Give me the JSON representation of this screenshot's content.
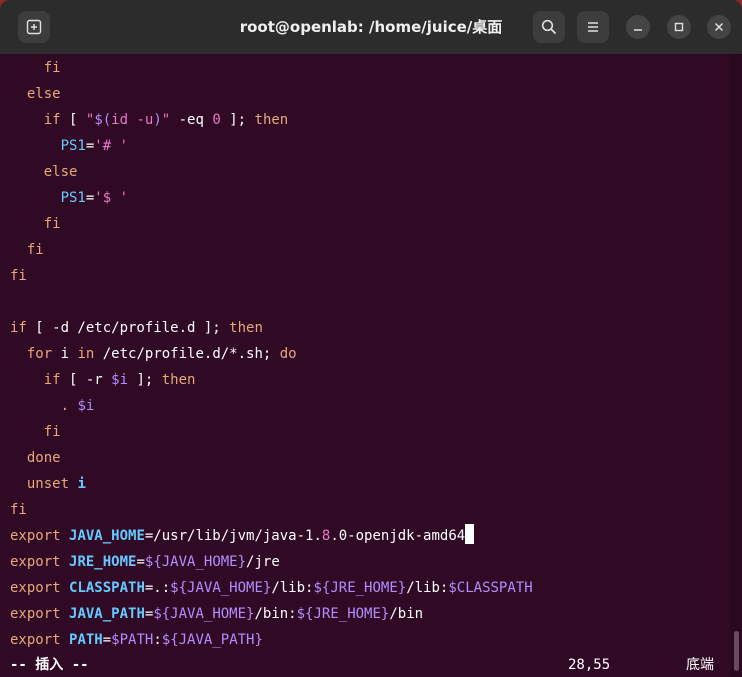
{
  "window": {
    "title": "root@openlab: /home/juice/桌面"
  },
  "colors": {
    "terminal_bg": "#300a24",
    "titlebar_bg": "#2c2c2c",
    "keyword": "#e8a87c",
    "string": "#e878c8",
    "variable": "#66c8ff",
    "comment": "#b38cff",
    "default": "#ffffff"
  },
  "icons": {
    "new_tab": "new-tab-icon",
    "search": "search-icon",
    "menu": "hamburger-menu-icon",
    "minimize": "minimize-icon",
    "maximize": "maximize-icon",
    "close": "close-icon"
  },
  "editor": {
    "lines": [
      [
        {
          "t": "    fi",
          "c": "#e8a87c"
        }
      ],
      [
        {
          "t": "  else",
          "c": "#e8a87c"
        }
      ],
      [
        {
          "t": "    if",
          "c": "#e8a87c"
        },
        {
          "t": " [ ",
          "c": "#ffffff"
        },
        {
          "t": "\"",
          "c": "#e878c8"
        },
        {
          "t": "$(",
          "c": "#b38cff"
        },
        {
          "t": "id -u",
          "c": "#e878c8"
        },
        {
          "t": ")",
          "c": "#b38cff"
        },
        {
          "t": "\"",
          "c": "#e878c8"
        },
        {
          "t": " -eq ",
          "c": "#ffffff"
        },
        {
          "t": "0",
          "c": "#e878c8"
        },
        {
          "t": " ]; ",
          "c": "#ffffff"
        },
        {
          "t": "then",
          "c": "#e8a87c"
        }
      ],
      [
        {
          "t": "      PS1",
          "c": "#66c8ff"
        },
        {
          "t": "=",
          "c": "#ffffff"
        },
        {
          "t": "'# '",
          "c": "#e878c8"
        }
      ],
      [
        {
          "t": "    else",
          "c": "#e8a87c"
        }
      ],
      [
        {
          "t": "      PS1",
          "c": "#66c8ff"
        },
        {
          "t": "=",
          "c": "#ffffff"
        },
        {
          "t": "'$ '",
          "c": "#e878c8"
        }
      ],
      [
        {
          "t": "    fi",
          "c": "#e8a87c"
        }
      ],
      [
        {
          "t": "  fi",
          "c": "#e8a87c"
        }
      ],
      [
        {
          "t": "fi",
          "c": "#e8a87c"
        }
      ],
      [
        {
          "t": "",
          "c": "#ffffff"
        }
      ],
      [
        {
          "t": "if",
          "c": "#e8a87c"
        },
        {
          "t": " [ -d /etc/profile.d ]; ",
          "c": "#ffffff"
        },
        {
          "t": "then",
          "c": "#e8a87c"
        }
      ],
      [
        {
          "t": "  for",
          "c": "#e8a87c"
        },
        {
          "t": " i ",
          "c": "#ffffff"
        },
        {
          "t": "in",
          "c": "#e8a87c"
        },
        {
          "t": " /etc/profile.d/*.sh; ",
          "c": "#ffffff"
        },
        {
          "t": "do",
          "c": "#e8a87c"
        }
      ],
      [
        {
          "t": "    if",
          "c": "#e8a87c"
        },
        {
          "t": " [ -r ",
          "c": "#ffffff"
        },
        {
          "t": "$i",
          "c": "#b38cff"
        },
        {
          "t": " ]; ",
          "c": "#ffffff"
        },
        {
          "t": "then",
          "c": "#e8a87c"
        }
      ],
      [
        {
          "t": "      . ",
          "c": "#e8a87c"
        },
        {
          "t": "$i",
          "c": "#b38cff"
        }
      ],
      [
        {
          "t": "    fi",
          "c": "#e8a87c"
        }
      ],
      [
        {
          "t": "  done",
          "c": "#e8a87c"
        }
      ],
      [
        {
          "t": "  unset",
          "c": "#e8a87c"
        },
        {
          "t": " ",
          "c": "#ffffff"
        },
        {
          "t": "i",
          "c": "#66c8ff",
          "b": true
        }
      ],
      [
        {
          "t": "fi",
          "c": "#e8a87c"
        }
      ],
      [
        {
          "t": "export",
          "c": "#e8a87c"
        },
        {
          "t": " ",
          "c": "#ffffff"
        },
        {
          "t": "JAVA_HOME",
          "c": "#66c8ff",
          "b": true
        },
        {
          "t": "=/usr/lib/jvm/java-1.",
          "c": "#ffffff"
        },
        {
          "t": "8",
          "c": "#e878c8"
        },
        {
          "t": ".0-openjdk-amd64",
          "c": "#ffffff"
        },
        {
          "t": "",
          "c": "#ffffff",
          "cursor": true
        }
      ],
      [
        {
          "t": "export",
          "c": "#e8a87c"
        },
        {
          "t": " ",
          "c": "#ffffff"
        },
        {
          "t": "JRE_HOME",
          "c": "#66c8ff",
          "b": true
        },
        {
          "t": "=",
          "c": "#ffffff"
        },
        {
          "t": "${JAVA_HOME}",
          "c": "#b38cff"
        },
        {
          "t": "/jre",
          "c": "#ffffff"
        }
      ],
      [
        {
          "t": "export",
          "c": "#e8a87c"
        },
        {
          "t": " ",
          "c": "#ffffff"
        },
        {
          "t": "CLASSPATH",
          "c": "#66c8ff",
          "b": true
        },
        {
          "t": "=.:",
          "c": "#ffffff"
        },
        {
          "t": "${JAVA_HOME}",
          "c": "#b38cff"
        },
        {
          "t": "/lib:",
          "c": "#ffffff"
        },
        {
          "t": "${JRE_HOME}",
          "c": "#b38cff"
        },
        {
          "t": "/lib:",
          "c": "#ffffff"
        },
        {
          "t": "$CLASSPATH",
          "c": "#b38cff"
        }
      ],
      [
        {
          "t": "export",
          "c": "#e8a87c"
        },
        {
          "t": " ",
          "c": "#ffffff"
        },
        {
          "t": "JAVA_PATH",
          "c": "#66c8ff",
          "b": true
        },
        {
          "t": "=",
          "c": "#ffffff"
        },
        {
          "t": "${JAVA_HOME}",
          "c": "#b38cff"
        },
        {
          "t": "/bin:",
          "c": "#ffffff"
        },
        {
          "t": "${JRE_HOME}",
          "c": "#b38cff"
        },
        {
          "t": "/bin",
          "c": "#ffffff"
        }
      ],
      [
        {
          "t": "export",
          "c": "#e8a87c"
        },
        {
          "t": " ",
          "c": "#ffffff"
        },
        {
          "t": "PATH",
          "c": "#66c8ff",
          "b": true
        },
        {
          "t": "=",
          "c": "#ffffff"
        },
        {
          "t": "$PATH",
          "c": "#b38cff"
        },
        {
          "t": ":",
          "c": "#ffffff"
        },
        {
          "t": "${JAVA_PATH}",
          "c": "#b38cff"
        }
      ]
    ]
  },
  "status": {
    "mode": "-- 插入 --",
    "position": "28,55",
    "scroll": "底端"
  }
}
